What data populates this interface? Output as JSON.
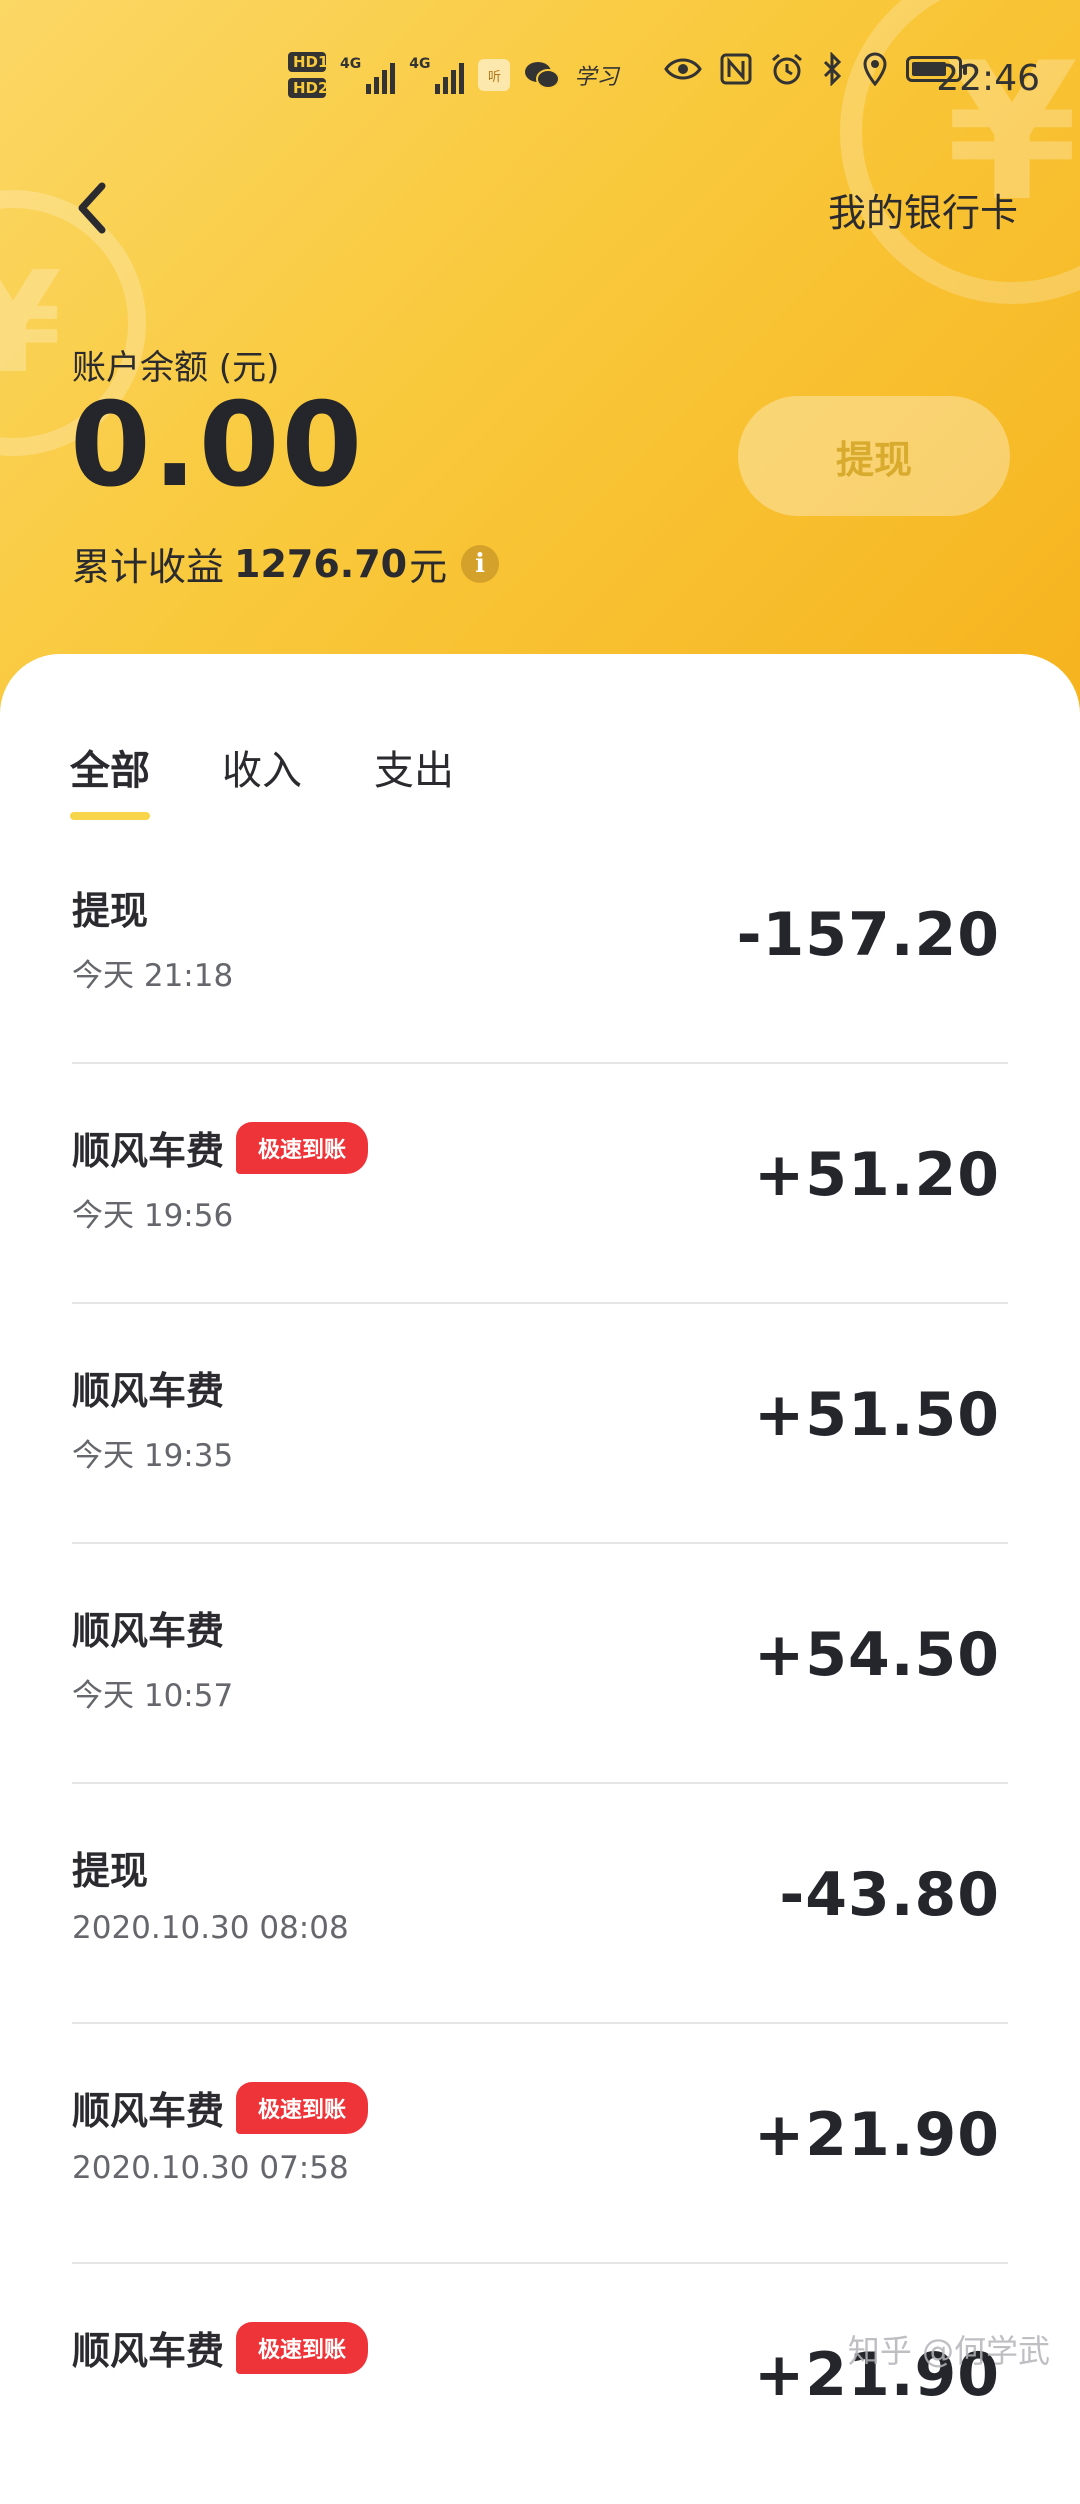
{
  "status_bar": {
    "hd1": "HD1",
    "hd2": "HD2",
    "net1": "4G",
    "net2": "4G",
    "app_icon_text": "听",
    "study_text": "学习",
    "time": "22:46"
  },
  "header": {
    "bank_card_link": "我的银行卡",
    "balance_label": "账户余额 (元)",
    "balance_value": "0.00",
    "withdraw_button": "提现",
    "earnings_label": "累计收益",
    "earnings_value": "1276.70",
    "earnings_unit": "元"
  },
  "tabs": [
    "全部",
    "收入",
    "支出"
  ],
  "active_tab": "全部",
  "transactions": [
    {
      "title": "提现",
      "badge": "",
      "time": "今天  21:18",
      "amount": "-157.20"
    },
    {
      "title": "顺风车费",
      "badge": "极速到账",
      "time": "今天  19:56",
      "amount": "+51.20"
    },
    {
      "title": "顺风车费",
      "badge": "",
      "time": "今天  19:35",
      "amount": "+51.50"
    },
    {
      "title": "顺风车费",
      "badge": "",
      "time": "今天  10:57",
      "amount": "+54.50"
    },
    {
      "title": "提现",
      "badge": "",
      "time": "2020.10.30 08:08",
      "amount": "-43.80"
    },
    {
      "title": "顺风车费",
      "badge": "极速到账",
      "time": "2020.10.30 07:58",
      "amount": "+21.90"
    },
    {
      "title": "顺风车费",
      "badge": "极速到账",
      "time": "",
      "amount": "+21.90"
    }
  ],
  "watermark": "知乎 @何学武",
  "colors": {
    "header_gradient_start": "#fbd765",
    "header_gradient_end": "#f6b31e",
    "badge_red": "#ef3439",
    "tab_underline": "#f7d64c"
  }
}
